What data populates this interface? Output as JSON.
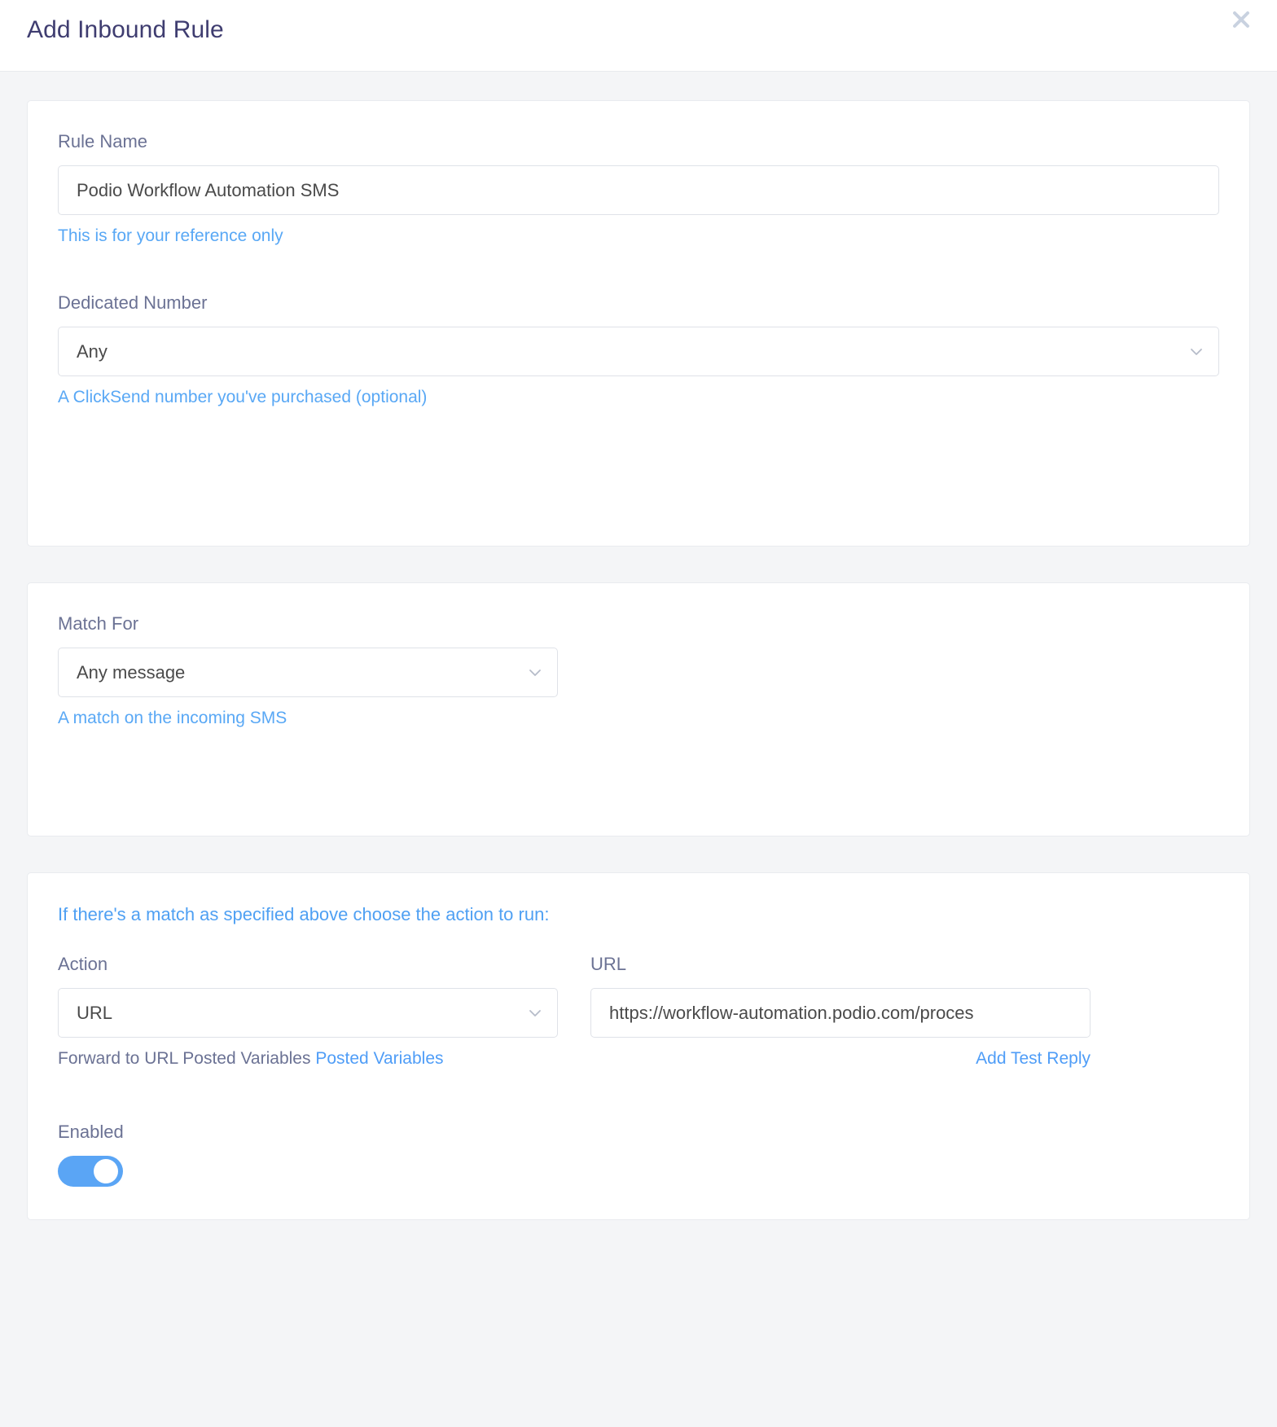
{
  "modal": {
    "title": "Add Inbound Rule",
    "close_icon": "close-icon"
  },
  "rule_name": {
    "label": "Rule Name",
    "value": "Podio Workflow Automation SMS",
    "placeholder": "Rule Name",
    "helper": "This is for your reference only"
  },
  "dedicated_number": {
    "label": "Dedicated Number",
    "value": "Any",
    "helper": "A ClickSend number you've purchased (optional)",
    "chevron_icon": "chevron-down-icon"
  },
  "match_for": {
    "label": "Match For",
    "value": "Any message",
    "helper": "A match on the incoming SMS",
    "chevron_icon": "chevron-down-icon"
  },
  "action_group": {
    "intro": "If there's a match as specified above choose the action to run:",
    "action": {
      "label": "Action",
      "value": "URL",
      "chevron_icon": "chevron-down-icon",
      "under_text": "Forward to URL Posted Variables ",
      "under_link": "Posted Variables"
    },
    "url": {
      "label": "URL",
      "value": "https://workflow-automation.podio.com/proces",
      "placeholder": "URL",
      "add_test_reply": "Add Test Reply"
    }
  },
  "enabled": {
    "label": "Enabled",
    "state": "on"
  },
  "colors": {
    "title": "#3f3d70",
    "label": "#6b7294",
    "link": "#59a8f5",
    "toggle_on": "#5aa5f5",
    "border": "#dfe2e8",
    "page_bg": "#f4f5f7"
  }
}
